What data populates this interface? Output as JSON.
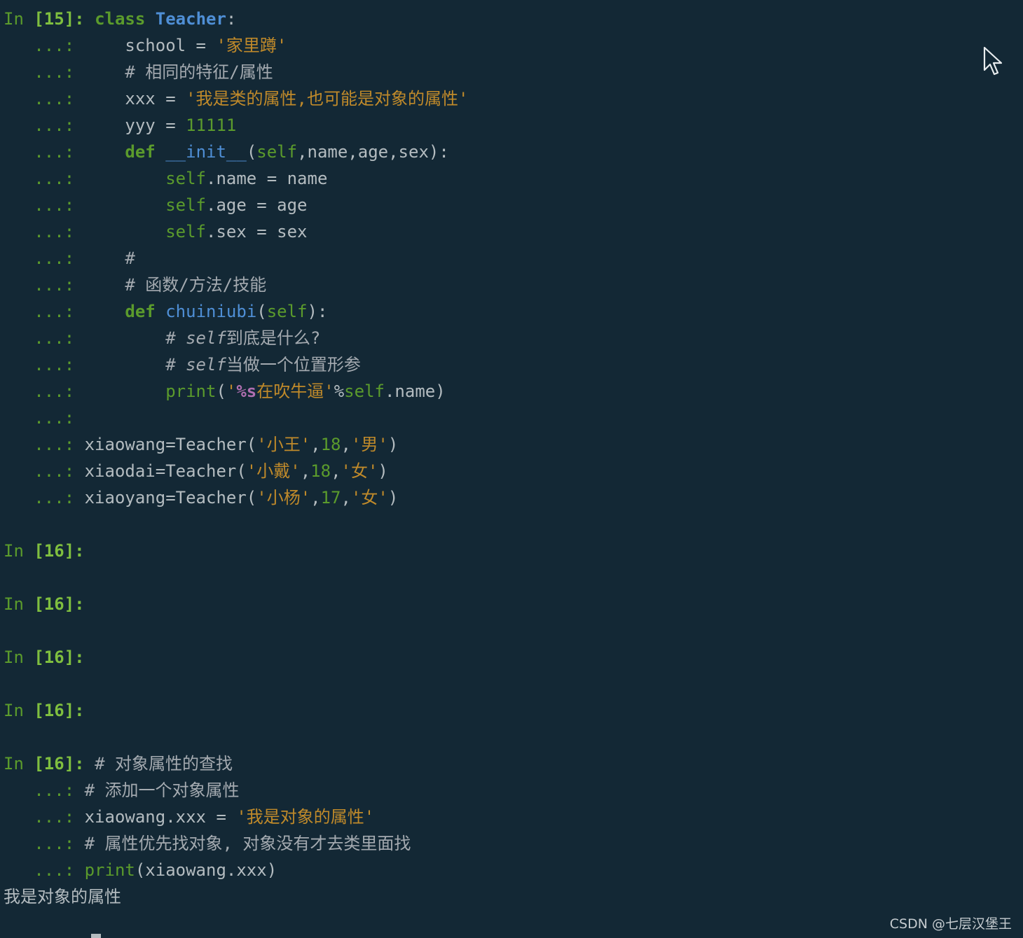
{
  "terminal": {
    "prompt_in": "In ",
    "prompt_15": "[15]:",
    "prompt_16": "[16]:",
    "cont": "   ...:",
    "cell1": {
      "class_kw": "class",
      "class_name": "Teacher",
      "colon": ":",
      "school_lhs": "    school = ",
      "school_val": "'家里蹲'",
      "comment1": "    # 相同的特征/属性",
      "xxx_lhs": "    xxx = ",
      "xxx_val": "'我是类的属性,也可能是对象的属性'",
      "yyy_lhs": "    yyy = ",
      "yyy_val": "11111",
      "def_kw": "    def",
      "init_name": "__init__",
      "init_open": "(",
      "self": "self",
      "init_args": ",name,age,sex):",
      "name_assign": ".name = name",
      "age_assign": ".age = age",
      "sex_assign": ".sex = sex",
      "hash_only": "    #",
      "comment2": "    # 函数/方法/技能",
      "chui_name": "chuiniubi",
      "chui_open": "(",
      "chui_close": "):",
      "c3_hash": "        # ",
      "c3_self": "self",
      "c3_rest": "到底是什么?",
      "c4_rest": "当做一个位置形参",
      "print_indent": "        ",
      "print_kw": "print",
      "print_open": "(",
      "print_str_q": "'",
      "print_fmt": "%s",
      "print_str_rest": "在吹牛逼'",
      "print_pct": "%",
      "print_tail": ".name)",
      "xiaowang_pre": "xiaowang=Teacher(",
      "xiaowang_name": "'小王'",
      "xiaowang_age": "18",
      "xiaowang_sex": "'男'",
      "xiaodai_pre": "xiaodai=Teacher(",
      "xiaodai_name": "'小戴'",
      "xiaodai_age": "18",
      "xiaodai_sex": "'女'",
      "xiaoyang_pre": "xiaoyang=Teacher(",
      "xiaoyang_name": "'小杨'",
      "xiaoyang_age": "17",
      "xiaoyang_sex": "'女'",
      "comma": ",",
      "close_paren": ")"
    },
    "cell2": {
      "comment1": "# 对象属性的查找",
      "comment2": "# 添加一个对象属性",
      "assign_lhs": "xiaowang.xxx = ",
      "assign_val": "'我是对象的属性'",
      "comment3": "# 属性优先找对象, 对象没有才去类里面找",
      "print_kw": "print",
      "print_args": "(xiaowang.xxx)",
      "output": "我是对象的属性"
    }
  },
  "watermark": "CSDN @七层汉堡王",
  "icons": {
    "mouse": "mouse-pointer-icon"
  }
}
